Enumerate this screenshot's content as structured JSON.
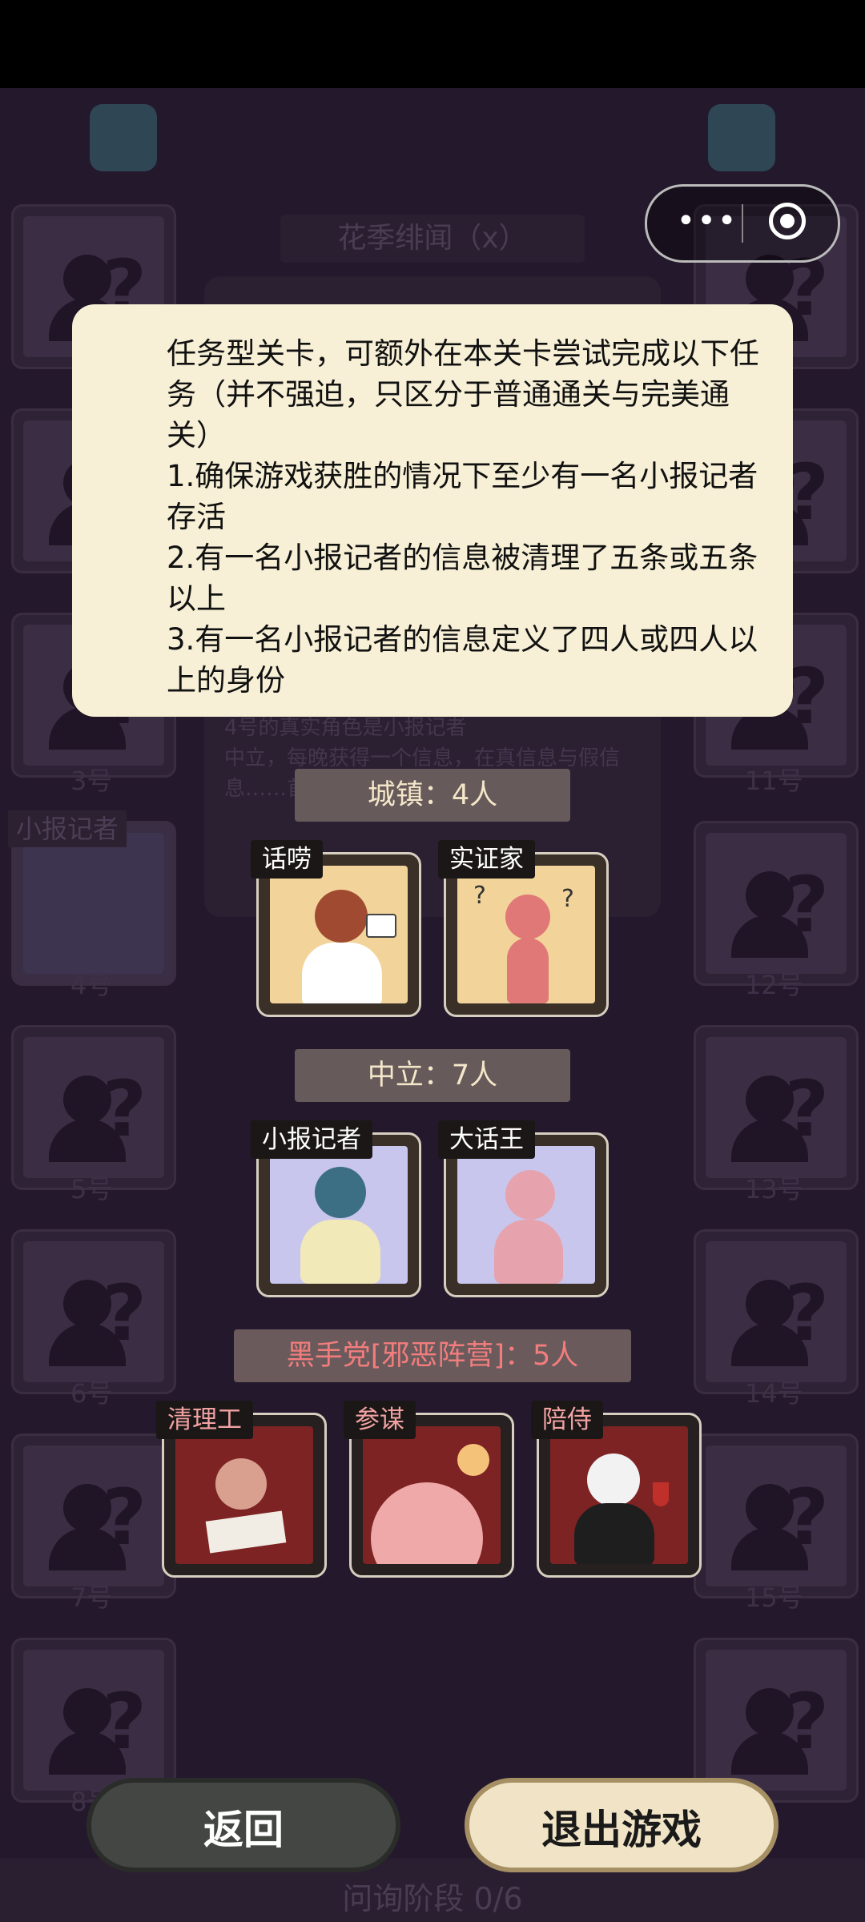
{
  "background": {
    "level_title": "花季绯闻（x）",
    "slot_numbers_left": [
      "3号",
      "4号",
      "5号",
      "6号",
      "7号",
      "8号"
    ],
    "slot_numbers_right": [
      "11号",
      "12号",
      "13号",
      "14号",
      "15号"
    ],
    "left_slot_role_tag": "小报记者",
    "description": "4号的真实角色是小报记者\n中立，每晚获得一个信息，在真信息与假信息……首晚是真……",
    "phase": "问询阶段 0/6"
  },
  "info_card": {
    "intro": "任务型关卡，可额外在本关卡尝试完成以下任务（并不强迫，只区分于普通通关与完美通关）",
    "tasks": [
      "1.确保游戏获胜的情况下至少有一名小报记者存活",
      "2.有一名小报记者的信息被清理了五条或五条以上",
      "3.有一名小报记者的信息定义了四人或四人以上的身份"
    ]
  },
  "sections": {
    "town": {
      "title": "城镇：4人",
      "roles": [
        "话唠",
        "实证家"
      ]
    },
    "neutral": {
      "title": "中立：7人",
      "roles": [
        "小报记者",
        "大话王"
      ]
    },
    "evil": {
      "title": "黑手党[邪恶阵营]：5人",
      "roles": [
        "清理工",
        "参谋",
        "陪侍"
      ]
    }
  },
  "buttons": {
    "back": "返回",
    "exit": "退出游戏"
  },
  "capsule": {
    "more": "•••"
  },
  "colors": {
    "card_bg": "#f7f0d6",
    "town_art": "#f2d49a",
    "neutral_art": "#c9c6ee",
    "evil_art": "#7e2323",
    "evil_text": "#f27d7d"
  }
}
